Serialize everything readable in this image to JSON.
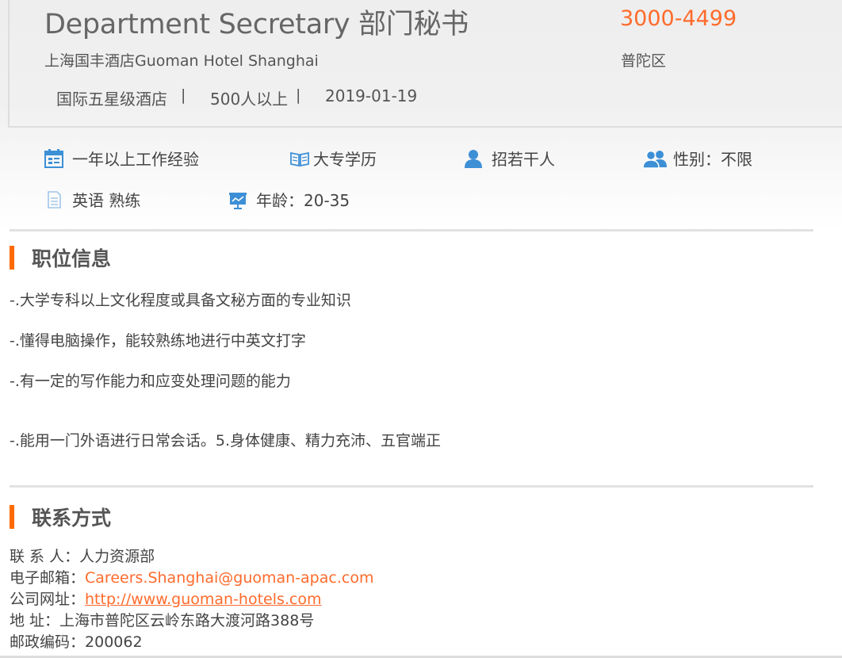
{
  "job": {
    "title": "Department Secretary 部门秘书",
    "salary": "3000-4499",
    "company": "上海国丰酒店Guoman Hotel Shanghai",
    "district": "普陀区",
    "meta": {
      "industry": "国际五星级酒店",
      "size": "500人以上",
      "date": "2019-01-19",
      "separator": "|"
    }
  },
  "requirements": [
    {
      "icon": "calendar-icon",
      "text": "一年以上工作经验"
    },
    {
      "icon": "book-icon",
      "text": "大专学历"
    },
    {
      "icon": "person-icon",
      "text": "招若干人"
    },
    {
      "icon": "people-icon",
      "text": "性别：不限"
    },
    {
      "icon": "document-icon",
      "text": "英语 熟练"
    },
    {
      "icon": "presentation-icon",
      "text": "年龄：20-35"
    }
  ],
  "sections": {
    "position_info": "职位信息",
    "contact": "联系方式"
  },
  "duties": [
    "-.大学专科以上文化程度或具备文秘方面的专业知识",
    "-.懂得电脑操作，能较熟练地进行中英文打字",
    "-.有一定的写作能力和应变处理问题的能力",
    "-.能用一门外语进行日常会话。5.身体健康、精力充沛、五官端正"
  ],
  "contact": {
    "person_label": "联 系 人：",
    "person": "人力资源部",
    "email_label": "电子邮箱：",
    "email": "Careers.Shanghai@guoman-apac.com",
    "website_label": "公司网址：",
    "website": "http://www.guoman-hotels.com",
    "address_label": "地 址：",
    "address": "上海市普陀区云岭东路大渡河路388号",
    "postcode_label": "邮政编码：",
    "postcode": "200062"
  },
  "colors": {
    "accent": "#ff6b2c",
    "section_bar": "#ff6b00",
    "icon_blue": "#3d8fd6"
  }
}
